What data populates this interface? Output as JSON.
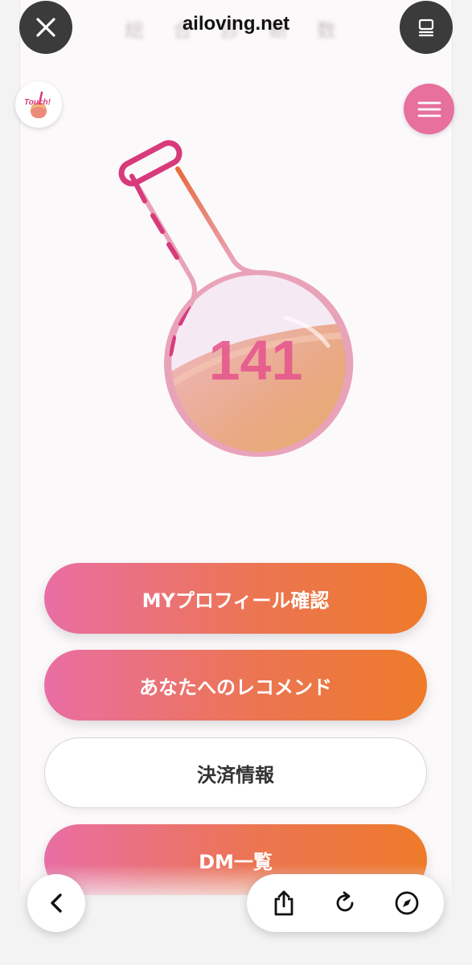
{
  "browser": {
    "domain": "ailoving.net",
    "blurred_title": "総 合 診 断 数"
  },
  "logo": {
    "text": "Touch!"
  },
  "counter": {
    "value": "141"
  },
  "buttons": {
    "profile": "MYプロフィール確認",
    "recommend": "あなたへのレコメンド",
    "payment": "決済情報",
    "dm": "DM一覧"
  },
  "colors": {
    "accent_pink": "#e96ea4",
    "accent_orange": "#ee7a2a",
    "menu_pink": "#e7709d",
    "flask_pink": "#d83a7c"
  },
  "icons": {
    "close": "close-icon",
    "tabs": "tabs-icon",
    "menu": "hamburger-menu-icon",
    "back": "chevron-left-icon",
    "share": "share-icon",
    "reload": "reload-icon",
    "safari": "compass-icon"
  }
}
